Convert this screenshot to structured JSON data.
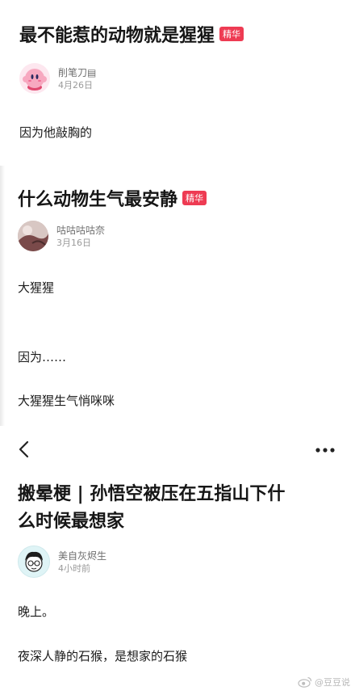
{
  "post1": {
    "title": "最不能惹的动物就是猩猩",
    "badge": "精华",
    "author_name": "削笔刀▤",
    "date": "4月26日",
    "body": "因为他敲胸的"
  },
  "post2": {
    "title": "什么动物生气最安静",
    "badge": "精华",
    "author_name": "咕咕咕咕奈",
    "date": "3月16日",
    "lines": [
      "大猩猩",
      "因为……",
      "大猩猩生气悄咪咪"
    ]
  },
  "post3": {
    "title_line1": "搬晕梗 | 孙悟空被压在五指山下什",
    "title_line2": "么时候最想家",
    "author_name": "美自灰烬生",
    "date": "4小时前",
    "lines": [
      "晚上。",
      "夜深人静的石猴，是想家的石猴"
    ]
  },
  "nav": {
    "back_icon": "chevron-left-icon",
    "more_icon": "more-dots-icon"
  },
  "watermark": {
    "text": "@豆豆说"
  },
  "colors": {
    "badge": "#ee3b53",
    "text": "#1c1c1c",
    "muted": "#9a9a9a"
  }
}
